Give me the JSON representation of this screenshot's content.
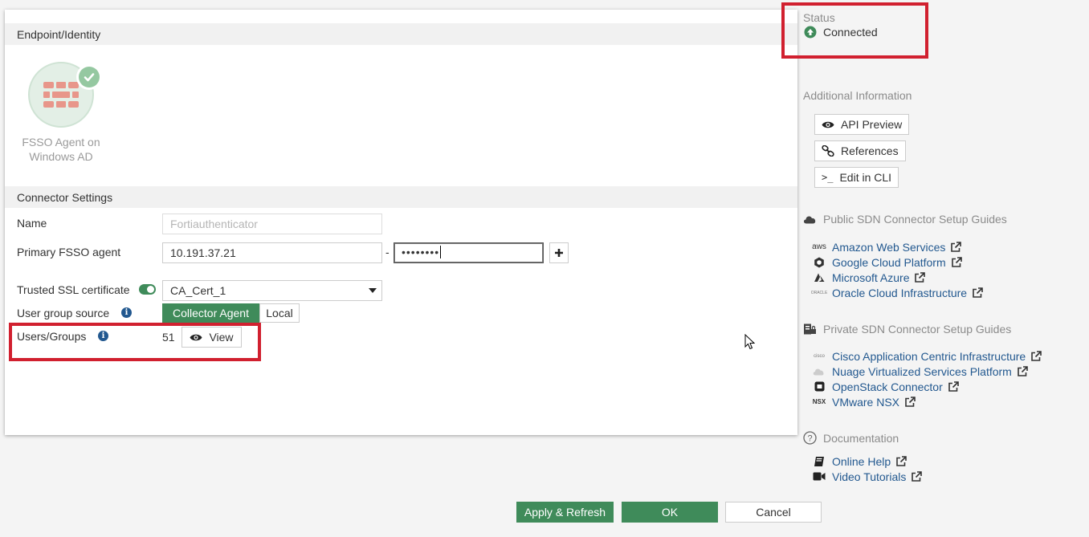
{
  "endpoint": {
    "section_title": "Endpoint/Identity",
    "caption": "FSSO Agent on Windows AD"
  },
  "connector": {
    "section_title": "Connector Settings",
    "name_label": "Name",
    "name_placeholder": "Fortiauthenticator",
    "agent_label": "Primary FSSO agent",
    "agent_value": "10.191.37.21",
    "separator": "-",
    "password_value": "••••••••",
    "ssl_label": "Trusted SSL certificate",
    "ssl_enabled": true,
    "ssl_value": "CA_Cert_1",
    "group_source_label": "User group source",
    "group_source_options": [
      "Collector Agent",
      "Local"
    ],
    "group_source_selected": "Collector Agent",
    "users_label": "Users/Groups",
    "users_count": "51",
    "view_label": "View"
  },
  "status": {
    "label": "Status",
    "value": "Connected",
    "color": "#3f8b5a"
  },
  "additional": {
    "title": "Additional Information",
    "buttons": [
      "API Preview",
      "References",
      "Edit in CLI"
    ]
  },
  "public_guides": {
    "title": "Public SDN Connector Setup Guides",
    "links": [
      {
        "label": "Amazon Web Services",
        "icon": "aws-icon"
      },
      {
        "label": "Google Cloud Platform",
        "icon": "gcp-icon"
      },
      {
        "label": "Microsoft Azure",
        "icon": "azure-icon"
      },
      {
        "label": "Oracle Cloud Infrastructure",
        "icon": "oracle-icon"
      }
    ]
  },
  "private_guides": {
    "title": "Private SDN Connector Setup Guides",
    "links": [
      {
        "label": "Cisco Application Centric Infrastructure",
        "icon": "cisco-icon"
      },
      {
        "label": "Nuage Virtualized Services Platform",
        "icon": "nuage-icon"
      },
      {
        "label": "OpenStack Connector",
        "icon": "openstack-icon"
      },
      {
        "label": "VMware NSX",
        "icon": "nsx-icon"
      }
    ]
  },
  "documentation": {
    "title": "Documentation",
    "links": [
      {
        "label": "Online Help",
        "icon": "book-icon"
      },
      {
        "label": "Video Tutorials",
        "icon": "video-icon"
      }
    ]
  },
  "icon_labels": {
    "aws": "aws",
    "oracle": "ORACLE",
    "cisco": "cisco",
    "nsx": "NSX",
    "cli": ">_"
  },
  "footer": {
    "apply_label": "Apply & Refresh",
    "ok_label": "OK",
    "cancel_label": "Cancel"
  },
  "colors": {
    "accent_green": "#3f8b5a",
    "link_blue": "#22588f",
    "highlight_red": "#d1202f"
  }
}
